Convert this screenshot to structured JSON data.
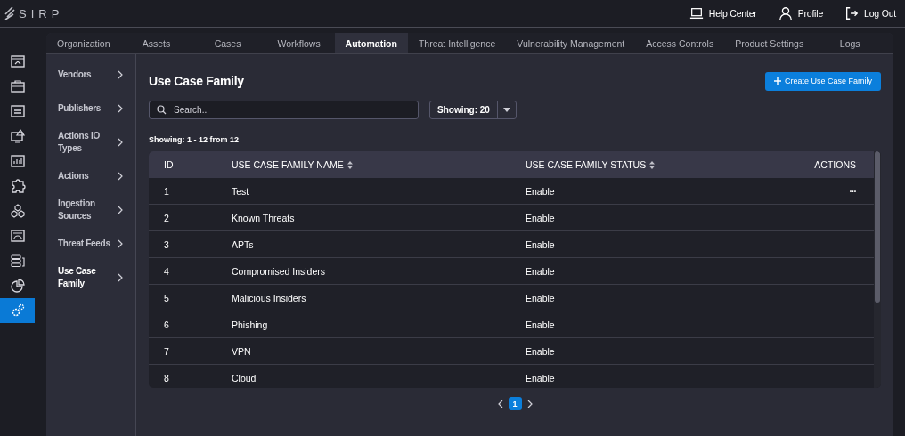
{
  "brand": {
    "name": "SIRP"
  },
  "header_links": [
    {
      "kind": "help",
      "label": "Help Center"
    },
    {
      "kind": "profile",
      "label": "Profile"
    },
    {
      "kind": "logout",
      "label": "Log Out"
    }
  ],
  "rail": [
    {
      "selected": false
    },
    {
      "selected": false
    },
    {
      "selected": false
    },
    {
      "selected": false
    },
    {
      "selected": false
    },
    {
      "selected": false
    },
    {
      "selected": false
    },
    {
      "selected": false
    },
    {
      "selected": false
    },
    {
      "selected": false
    },
    {
      "selected": true
    }
  ],
  "tabs": [
    {
      "label": "Organization",
      "selected": false
    },
    {
      "label": "Assets",
      "selected": false
    },
    {
      "label": "Cases",
      "selected": false
    },
    {
      "label": "Workflows",
      "selected": false
    },
    {
      "label": "Automation",
      "selected": true
    },
    {
      "label": "Threat Intelligence",
      "selected": false
    },
    {
      "label": "Vulnerability Management",
      "selected": false
    },
    {
      "label": "Access Controls",
      "selected": false
    },
    {
      "label": "Product Settings",
      "selected": false
    },
    {
      "label": "Logs",
      "selected": false
    }
  ],
  "sidebar": {
    "items": [
      {
        "label": "Vendors",
        "selected": false
      },
      {
        "label": "Publishers",
        "selected": false
      },
      {
        "label": "Actions IO Types",
        "selected": false
      },
      {
        "label": "Actions",
        "selected": false
      },
      {
        "label": "Ingestion Sources",
        "selected": false
      },
      {
        "label": "Threat Feeds",
        "selected": false
      },
      {
        "label": "Use Case Family",
        "selected": true
      }
    ]
  },
  "page": {
    "title": "Use Case Family",
    "create_button": "Create Use Case Family",
    "search": {
      "placeholder": "Search.."
    },
    "page_size": "Showing: 20",
    "summary": "Showing: 1 - 12 from 12"
  },
  "table": {
    "columns": [
      {
        "label": "ID",
        "sortable": false
      },
      {
        "label": "USE CASE FAMILY NAME",
        "sortable": true
      },
      {
        "label": "USE CASE FAMILY STATUS",
        "sortable": true
      },
      {
        "label": "ACTIONS",
        "sortable": false
      }
    ],
    "rows": [
      {
        "id": "1",
        "name": "Test",
        "status": "Enable",
        "actions": "···"
      },
      {
        "id": "2",
        "name": "Known Threats",
        "status": "Enable"
      },
      {
        "id": "3",
        "name": "APTs",
        "status": "Enable"
      },
      {
        "id": "4",
        "name": "Compromised Insiders",
        "status": "Enable"
      },
      {
        "id": "5",
        "name": "Malicious Insiders",
        "status": "Enable"
      },
      {
        "id": "6",
        "name": "Phishing",
        "status": "Enable"
      },
      {
        "id": "7",
        "name": "VPN",
        "status": "Enable"
      },
      {
        "id": "8",
        "name": "Cloud",
        "status": "Enable"
      }
    ]
  },
  "pagination": {
    "pages": [
      {
        "label": "1",
        "selected": true
      }
    ]
  }
}
